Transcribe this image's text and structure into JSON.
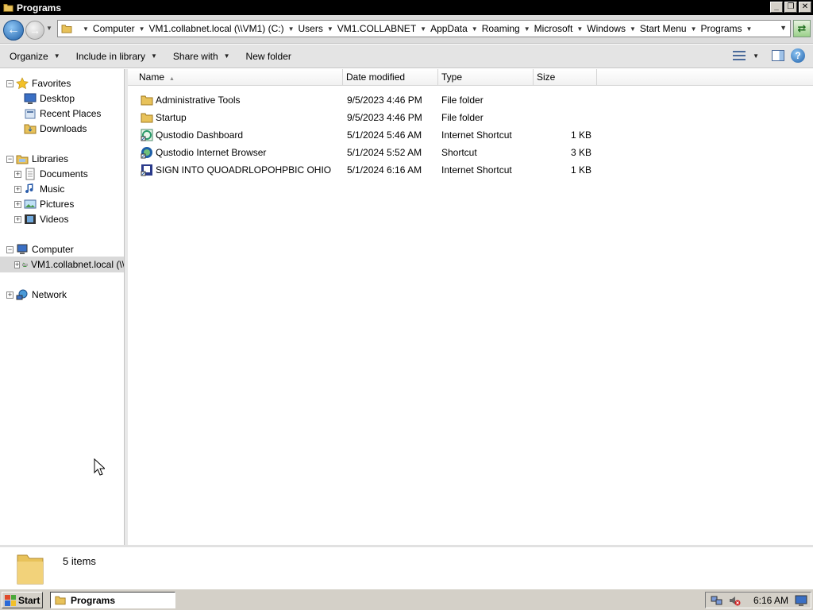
{
  "window": {
    "title": "Programs",
    "minimize_glyph": "_",
    "restore_glyph": "❐",
    "close_glyph": "✕"
  },
  "address": {
    "breadcrumbs": [
      "Computer",
      "VM1.collabnet.local (\\\\VM1) (C:)",
      "Users",
      "VM1.COLLABNET",
      "AppData",
      "Roaming",
      "Microsoft",
      "Windows",
      "Start Menu",
      "Programs"
    ]
  },
  "toolbar": {
    "organize": "Organize",
    "include_in_library": "Include in library",
    "share_with": "Share with",
    "new_folder": "New folder"
  },
  "navpane": {
    "favorites": "Favorites",
    "desktop": "Desktop",
    "recent_places": "Recent Places",
    "downloads": "Downloads",
    "libraries": "Libraries",
    "documents": "Documents",
    "music": "Music",
    "pictures": "Pictures",
    "videos": "Videos",
    "computer": "Computer",
    "network_drive": "VM1.collabnet.local (\\\\",
    "network": "Network"
  },
  "columns": {
    "name": "Name",
    "date_modified": "Date modified",
    "type": "Type",
    "size": "Size"
  },
  "files": [
    {
      "name": "Administrative Tools",
      "date": "9/5/2023 4:46 PM",
      "type": "File folder",
      "size": "",
      "icon": "folder-icon"
    },
    {
      "name": "Startup",
      "date": "9/5/2023 4:46 PM",
      "type": "File folder",
      "size": "",
      "icon": "folder-icon"
    },
    {
      "name": "Qustodio Dashboard",
      "date": "5/1/2024 5:46 AM",
      "type": "Internet Shortcut",
      "size": "1 KB",
      "icon": "internet-shortcut-icon"
    },
    {
      "name": "Qustodio Internet Browser",
      "date": "5/1/2024 5:52 AM",
      "type": "Shortcut",
      "size": "3 KB",
      "icon": "shortcut-icon"
    },
    {
      "name": "SIGN INTO QUOADRLOPOHPBIC OHIO",
      "date": "5/1/2024 6:16 AM",
      "type": "Internet Shortcut",
      "size": "1 KB",
      "icon": "internet-shortcut-icon"
    }
  ],
  "details": {
    "item_count": "5 items"
  },
  "taskbar": {
    "start": "Start",
    "task_label": "Programs",
    "clock": "6:16 AM"
  },
  "colors": {
    "folder": "#e8c25a",
    "accent_blue": "#1f5fa8",
    "titlebar": "#000000",
    "taskbar": "#d4d0c8"
  }
}
